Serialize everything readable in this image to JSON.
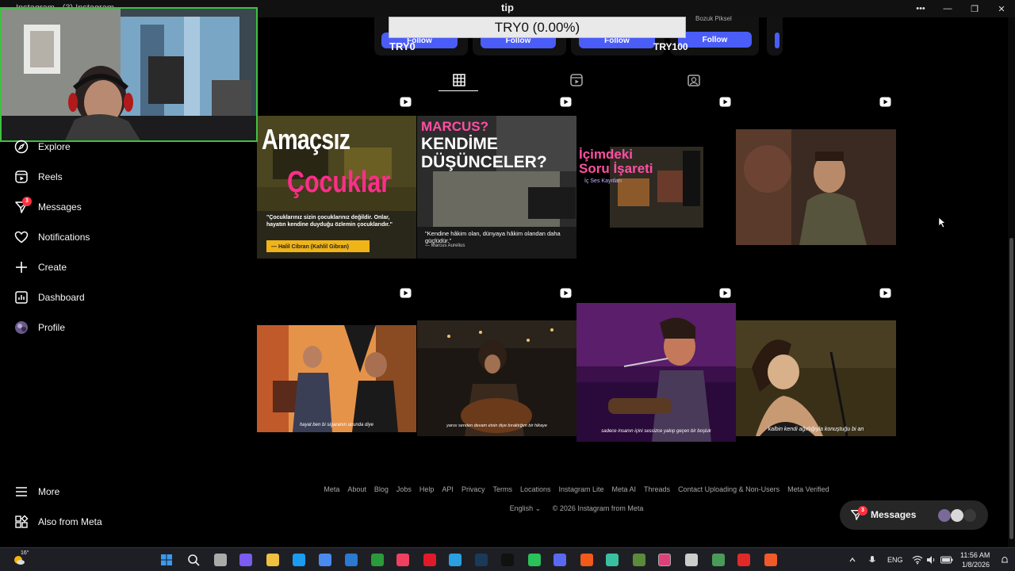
{
  "window": {
    "title": "Instagram - (3) Instagram",
    "center_title": "tip",
    "controls": [
      "more",
      "minimize",
      "restore",
      "close"
    ]
  },
  "tip_overlay": {
    "text": "TRY0 (0.00%)"
  },
  "suggestions": {
    "follow_label": "Follow",
    "card_name": "Bozuk Piksel",
    "amount_left": "TRY0",
    "amount_right": "TRY100"
  },
  "tabs": [
    {
      "icon": "grid-icon",
      "active": true
    },
    {
      "icon": "reels-icon",
      "active": false
    },
    {
      "icon": "tagged-icon",
      "active": false
    }
  ],
  "posts": [
    {
      "title_line1": "Amaçsız",
      "title_line2": "Çocuklar",
      "quote": "\"Çocuklarınız sizin çocuklarınız değildir. Onlar, hayatın kendine duyduğu özlemin çocuklarıdır.\"",
      "author": "— Halil Cibran (Kahlil Gibran)"
    },
    {
      "title_line1": "MARCUS?",
      "title_line2": "KENDİME",
      "title_line3": "DÜŞÜNCELER?",
      "quote": "\"Kendine hâkim olan, dünyaya hâkim olandan daha güçlüdür.\"",
      "author": "— Marcus Aurelius"
    },
    {
      "title_line1": "İçimdeki",
      "title_line2": "Soru İşareti",
      "subtitle": "İç Ses Kayıtları"
    },
    {
      "subtitle": ""
    },
    {
      "caption": "hayat ben bi sigaranın ucunda diye"
    },
    {
      "caption": "yarısı senden devam etsin diye bıraktığım bir hikaye"
    },
    {
      "caption": "sadece insanın içini sessizce yakıp geçen bir boşluk"
    },
    {
      "caption": "kalbin kendi ağırlığıyla konuştuğu bi an"
    }
  ],
  "sidebar": {
    "items": [
      {
        "label": "Explore",
        "icon": "compass-icon"
      },
      {
        "label": "Reels",
        "icon": "reels-icon"
      },
      {
        "label": "Messages",
        "icon": "messenger-icon",
        "badge": "3"
      },
      {
        "label": "Notifications",
        "icon": "heart-icon"
      },
      {
        "label": "Create",
        "icon": "plus-icon"
      },
      {
        "label": "Dashboard",
        "icon": "dashboard-icon"
      },
      {
        "label": "Profile",
        "icon": "avatar"
      }
    ],
    "bottom": [
      {
        "label": "More",
        "icon": "menu-icon"
      },
      {
        "label": "Also from Meta",
        "icon": "meta-apps-icon"
      }
    ]
  },
  "footer": {
    "links": [
      "Meta",
      "About",
      "Blog",
      "Jobs",
      "Help",
      "API",
      "Privacy",
      "Terms",
      "Locations",
      "Instagram Lite",
      "Meta AI",
      "Threads",
      "Contact Uploading & Non-Users",
      "Meta Verified"
    ],
    "language": "English",
    "copyright": "© 2026 Instagram from Meta"
  },
  "messages_pill": {
    "label": "Messages",
    "badge": "3"
  },
  "taskbar": {
    "weather": "16°",
    "language": "ENG",
    "time": "11:56 AM",
    "date": "1/8/2026",
    "icons": [
      "start-icon",
      "search-icon",
      "taskview-icon",
      "copilot-icon",
      "explorer-icon",
      "edge-icon",
      "store-icon",
      "vscode-icon",
      "xbox-icon",
      "music-icon",
      "opera-icon",
      "telegram-icon",
      "steam-icon",
      "tiktok-icon",
      "whatsapp-icon",
      "discord-icon",
      "brave-icon",
      "app-icon",
      "minecraft-icon",
      "instagram-icon",
      "obs-icon",
      "app2-icon",
      "youtube-icon",
      "brave2-icon"
    ]
  }
}
